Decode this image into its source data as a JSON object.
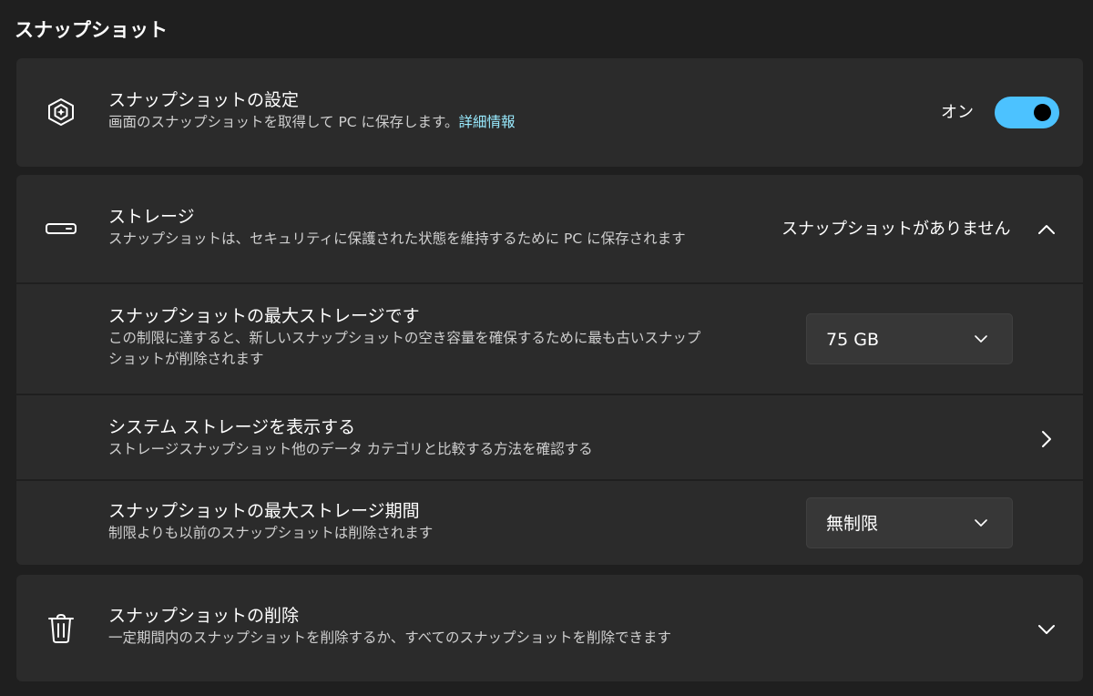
{
  "page": {
    "title": "スナップショット"
  },
  "snapshot_setting": {
    "title": "スナップショットの設定",
    "desc": "画面のスナップショットを取得して PC に保存します。",
    "link": "詳細情報",
    "toggle_label": "オン",
    "toggle_on": true,
    "icon": "snapshot-icon"
  },
  "storage": {
    "title": "ストレージ",
    "desc": "スナップショットは、セキュリティに保護された状態を維持するために PC に保存されます",
    "status": "スナップショットがありません",
    "icon": "storage-drive-icon",
    "expanded": true,
    "items": {
      "max_storage": {
        "title": "スナップショットの最大ストレージです",
        "desc_line1": "この制限に達すると、新しいスナップショットの空き容量を確保するために最も古いスナップ",
        "desc_line2": "ショットが削除されます",
        "value": "75 GB"
      },
      "system_storage": {
        "title": "システム ストレージを表示する",
        "desc": "ストレージスナップショット他のデータ カテゴリと比較する方法を確認する"
      },
      "max_period": {
        "title": "スナップショットの最大ストレージ期間",
        "desc": "制限よりも以前のスナップショットは削除されます",
        "value": "無制限"
      }
    }
  },
  "delete": {
    "title": "スナップショットの削除",
    "desc": "一定期間内のスナップショットを削除するか、すべてのスナップショットを削除できます",
    "icon": "trash-icon",
    "expanded": false
  },
  "colors": {
    "background": "#1f1f1f",
    "card": "#2b2b2b",
    "accent": "#4cc2ff",
    "link": "#99ebff"
  }
}
